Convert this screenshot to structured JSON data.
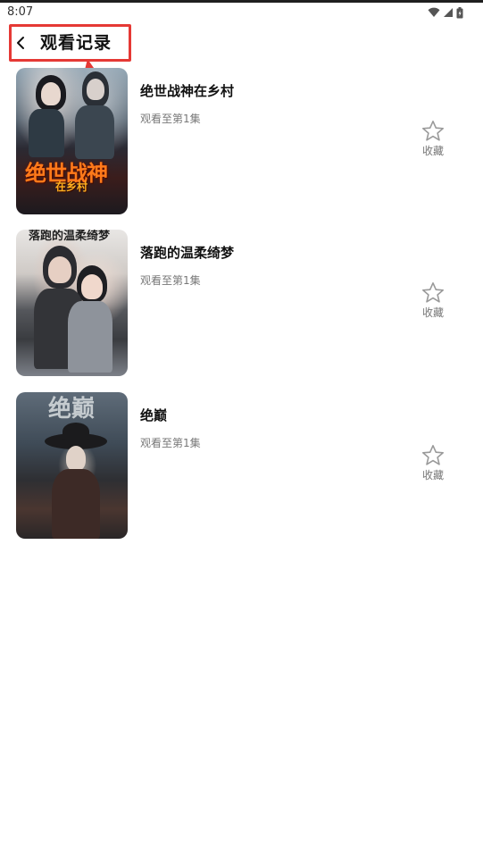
{
  "status_bar": {
    "time": "8:07",
    "icons": [
      "wifi-icon",
      "cellular-icon",
      "battery-icon"
    ]
  },
  "header": {
    "title": "观看记录",
    "back_icon": "chevron-left-icon",
    "highlight_color": "#e53935"
  },
  "history": {
    "items": [
      {
        "title": "绝世战神在乡村",
        "progress": "观看至第1集",
        "favorite_label": "收藏",
        "favorite_icon": "star-outline-icon",
        "poster_text": "绝世战神",
        "poster_subtext": "在乡村"
      },
      {
        "title": "落跑的温柔绮梦",
        "progress": "观看至第1集",
        "favorite_label": "收藏",
        "favorite_icon": "star-outline-icon",
        "poster_text": "落跑的温柔绮梦"
      },
      {
        "title": "绝巅",
        "progress": "观看至第1集",
        "favorite_label": "收藏",
        "favorite_icon": "star-outline-icon",
        "poster_text": "绝巅"
      }
    ]
  }
}
